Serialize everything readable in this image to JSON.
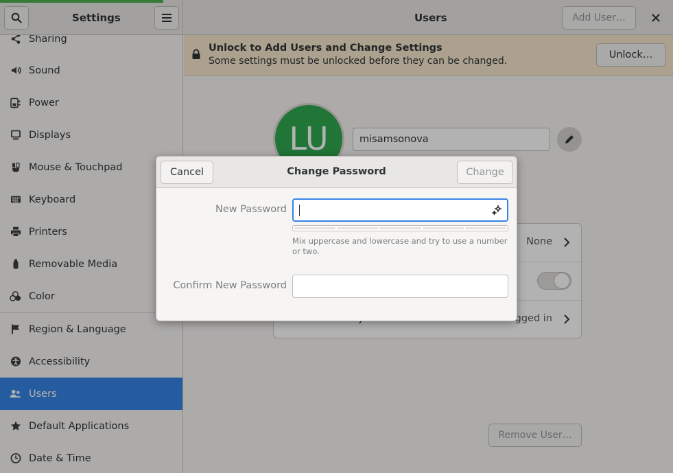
{
  "sidebar": {
    "title": "Settings",
    "items": [
      {
        "label": "Sharing",
        "icon": "share-icon"
      },
      {
        "label": "Sound",
        "icon": "speaker-icon"
      },
      {
        "label": "Power",
        "icon": "power-icon"
      },
      {
        "label": "Displays",
        "icon": "display-icon"
      },
      {
        "label": "Mouse & Touchpad",
        "icon": "mouse-icon"
      },
      {
        "label": "Keyboard",
        "icon": "keyboard-icon"
      },
      {
        "label": "Printers",
        "icon": "printer-icon"
      },
      {
        "label": "Removable Media",
        "icon": "usb-icon"
      },
      {
        "label": "Color",
        "icon": "color-icon"
      },
      {
        "label": "Region & Language",
        "icon": "flag-icon"
      },
      {
        "label": "Accessibility",
        "icon": "accessibility-icon"
      },
      {
        "label": "Users",
        "icon": "users-icon",
        "selected": true
      },
      {
        "label": "Default Applications",
        "icon": "star-icon"
      },
      {
        "label": "Date & Time",
        "icon": "clock-icon"
      }
    ]
  },
  "header": {
    "title": "Users",
    "add_user_label": "Add User…",
    "close_label": "×"
  },
  "infobar": {
    "title": "Unlock to Add Users and Change Settings",
    "subtitle": "Some settings must be unlocked before they can be changed.",
    "unlock_label": "Unlock…"
  },
  "user": {
    "initials": "LU",
    "username": "misamsonova"
  },
  "details": {
    "password_value": "None",
    "account_activity_label": "Account Activity",
    "account_activity_value": "Logged in"
  },
  "remove_user_label": "Remove User…",
  "dialog": {
    "title": "Change Password",
    "cancel_label": "Cancel",
    "change_label": "Change",
    "new_password_label": "New Password",
    "new_password_value": "",
    "hint": "Mix uppercase and lowercase and try to use a number or two.",
    "confirm_label": "Confirm New Password",
    "confirm_value": "",
    "strength_level": 0
  },
  "colors": {
    "accent": "#3584e4",
    "avatar": "#2ea84f",
    "infobar": "#f6e7cd"
  }
}
